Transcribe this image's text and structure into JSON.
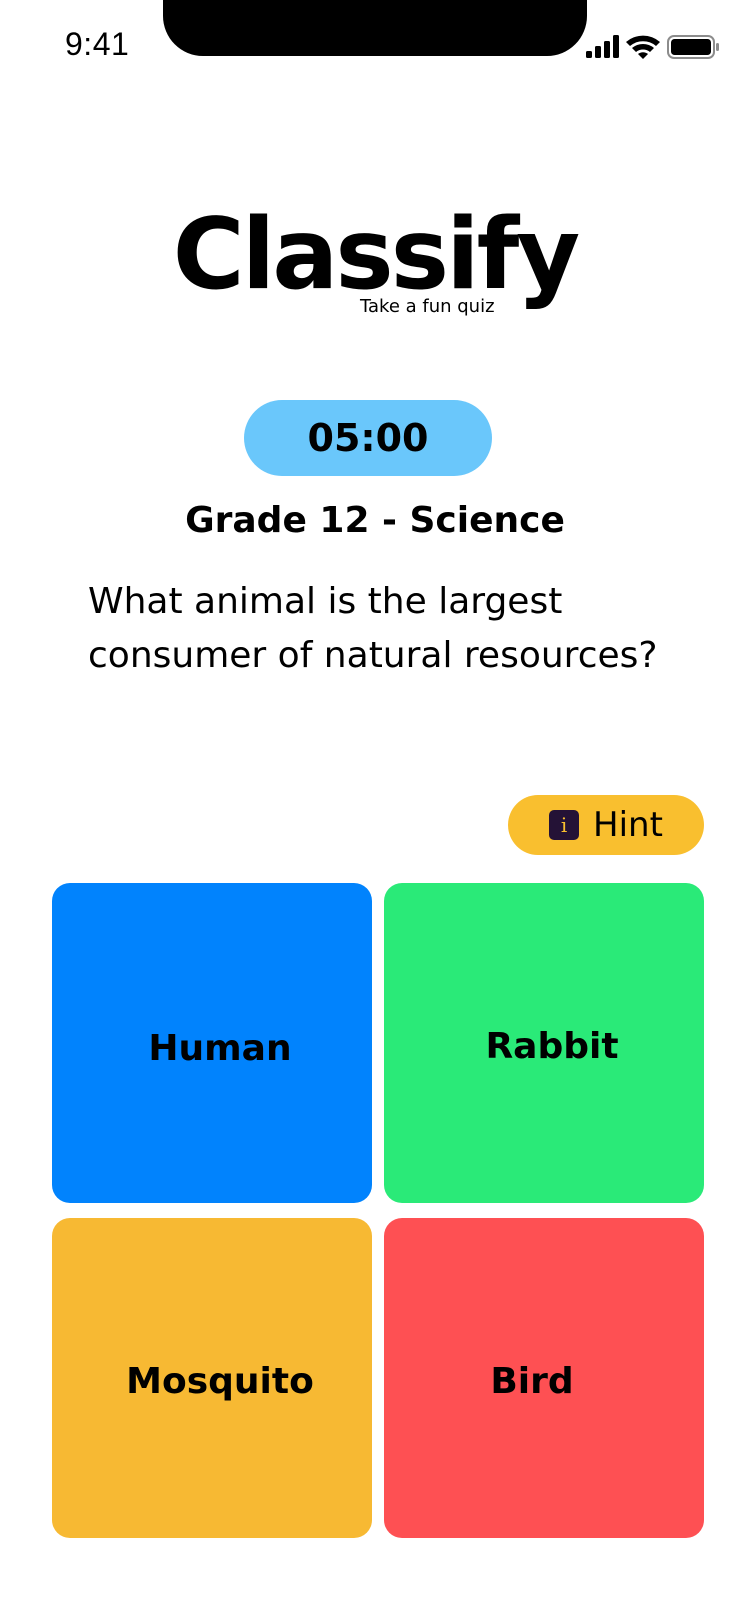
{
  "status_bar": {
    "time": "9:41",
    "icons": [
      "cellular-signal-icon",
      "wifi-icon",
      "battery-icon"
    ]
  },
  "logo": {
    "title": "Classify",
    "subtitle": "Take a fun quiz"
  },
  "quiz": {
    "timer": "05:00",
    "subject": "Grade 12 - Science",
    "question": "What animal is the largest consumer of natural resources?",
    "hint": {
      "label": "Hint",
      "icon": "info-icon",
      "icon_glyph": "i"
    },
    "answers": [
      {
        "label": "Human",
        "color": "#0183fd"
      },
      {
        "label": "Rabbit",
        "color": "#2aea78"
      },
      {
        "label": "Mosquito",
        "color": "#f7b933"
      },
      {
        "label": "Bird",
        "color": "#fe5053"
      }
    ]
  },
  "colors": {
    "timer_background": "#6ac7fb",
    "hint_background": "#f9bf2f",
    "hint_icon_background": "#241236",
    "text": "#000000",
    "background": "#ffffff"
  }
}
